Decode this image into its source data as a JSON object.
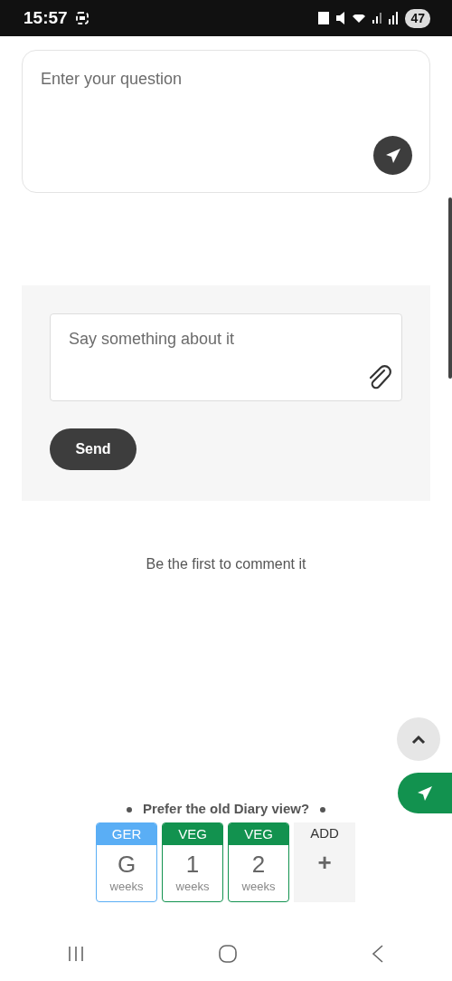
{
  "status_bar": {
    "time": "15:57",
    "battery": "47"
  },
  "question": {
    "placeholder": "Enter your question"
  },
  "comment_form": {
    "placeholder": "Say something about it",
    "button": "Send"
  },
  "empty_message": "Be the first to comment it",
  "old_view_prompt": "Prefer the old Diary view?",
  "week_cards": [
    {
      "label": "GER",
      "value": "G",
      "unit": "weeks",
      "color": "#5aaef5"
    },
    {
      "label": "VEG",
      "value": "1",
      "unit": "weeks",
      "color": "#12924f"
    },
    {
      "label": "VEG",
      "value": "2",
      "unit": "weeks",
      "color": "#12924f"
    }
  ],
  "add_tile": {
    "label": "ADD",
    "symbol": "+"
  }
}
